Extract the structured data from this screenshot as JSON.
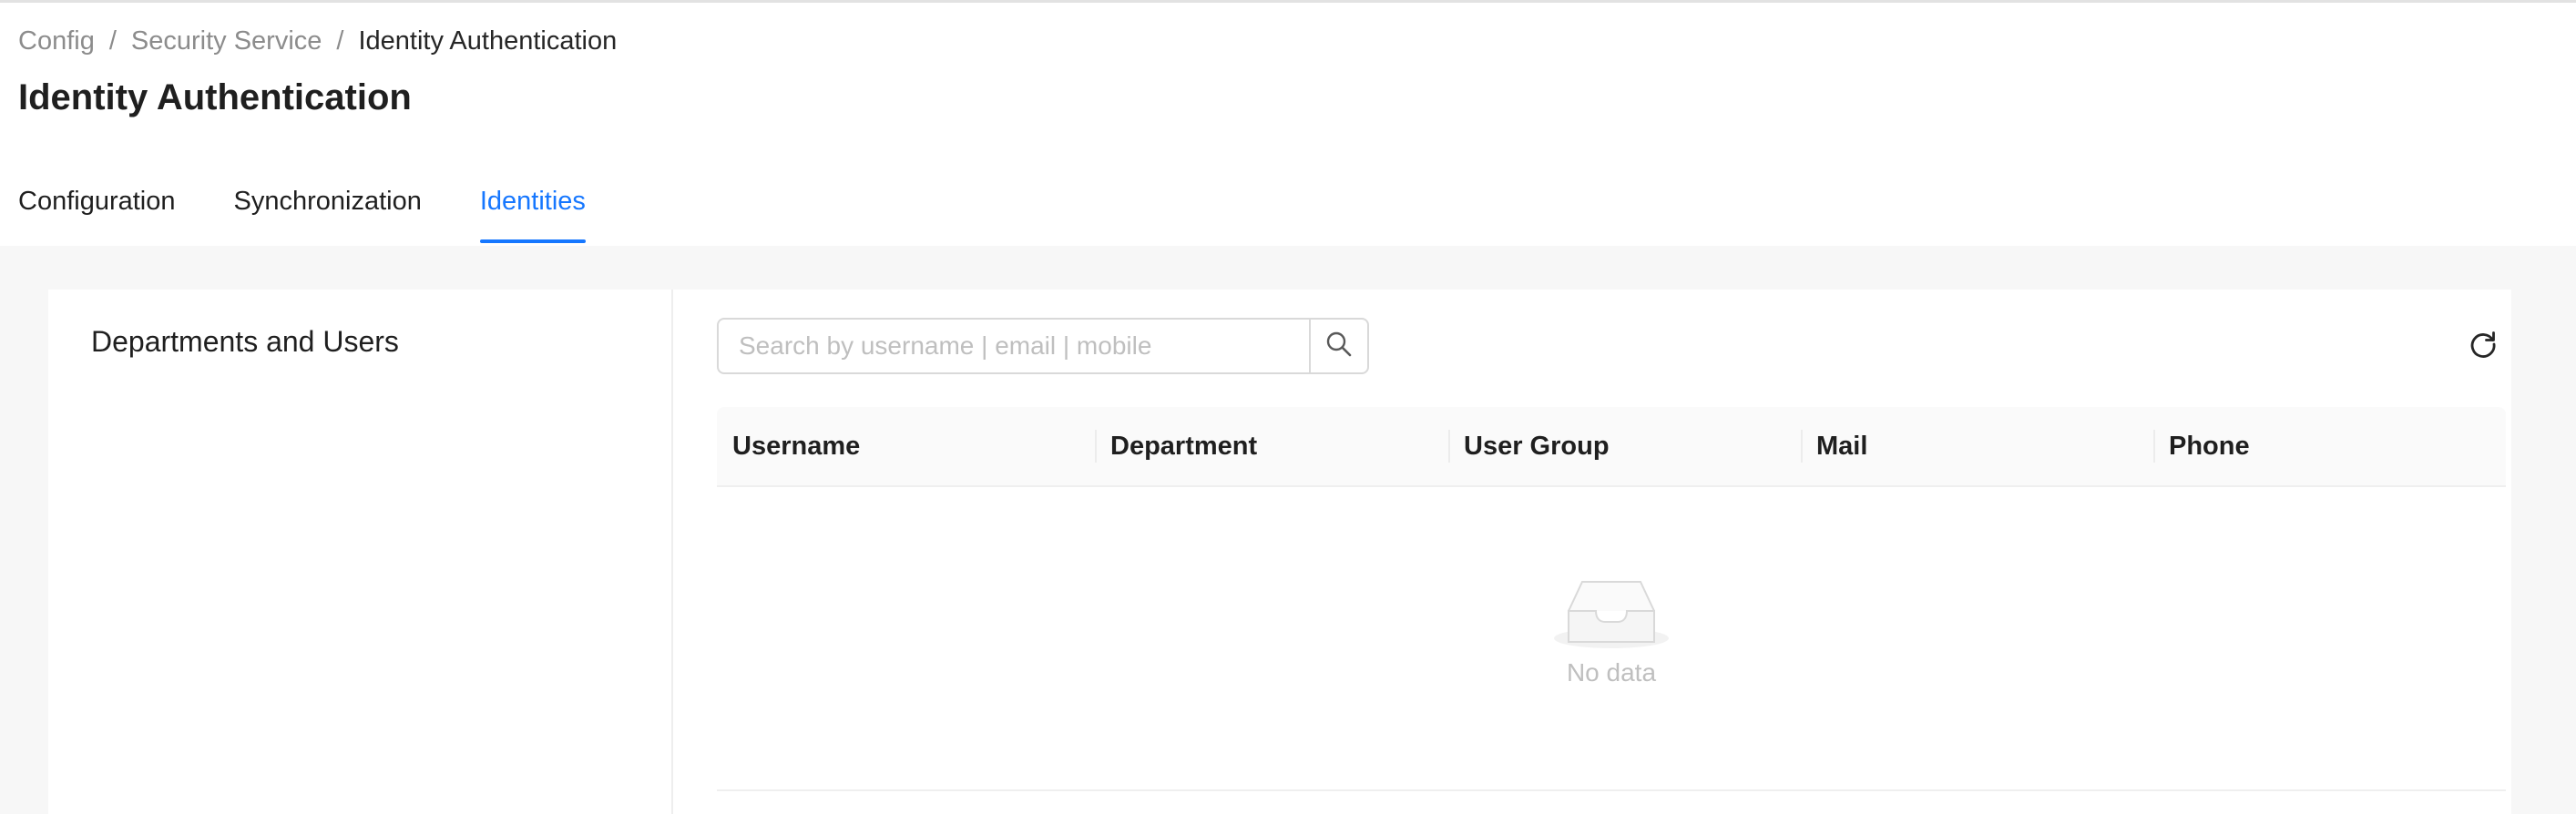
{
  "breadcrumb": {
    "items": [
      "Config",
      "Security Service",
      "Identity Authentication"
    ],
    "separator": "/"
  },
  "page": {
    "title": "Identity Authentication"
  },
  "tabs": [
    {
      "label": "Configuration",
      "active": false
    },
    {
      "label": "Synchronization",
      "active": false
    },
    {
      "label": "Identities",
      "active": true
    }
  ],
  "left_panel": {
    "title": "Departments and Users"
  },
  "search": {
    "placeholder": "Search by username | email | mobile",
    "value": "",
    "icon": "search-icon"
  },
  "toolbar": {
    "refresh_icon": "refresh-icon"
  },
  "table": {
    "columns": [
      "Username",
      "Department",
      "User Group",
      "Mail",
      "Phone"
    ],
    "rows": [],
    "empty_text": "No data",
    "empty_icon": "empty-inbox-icon"
  },
  "colors": {
    "accent": "#1677ff",
    "text": "#1f1f1f",
    "muted": "#8c8c8c",
    "placeholder": "#bfbfbf",
    "background": "#f7f7f7"
  }
}
